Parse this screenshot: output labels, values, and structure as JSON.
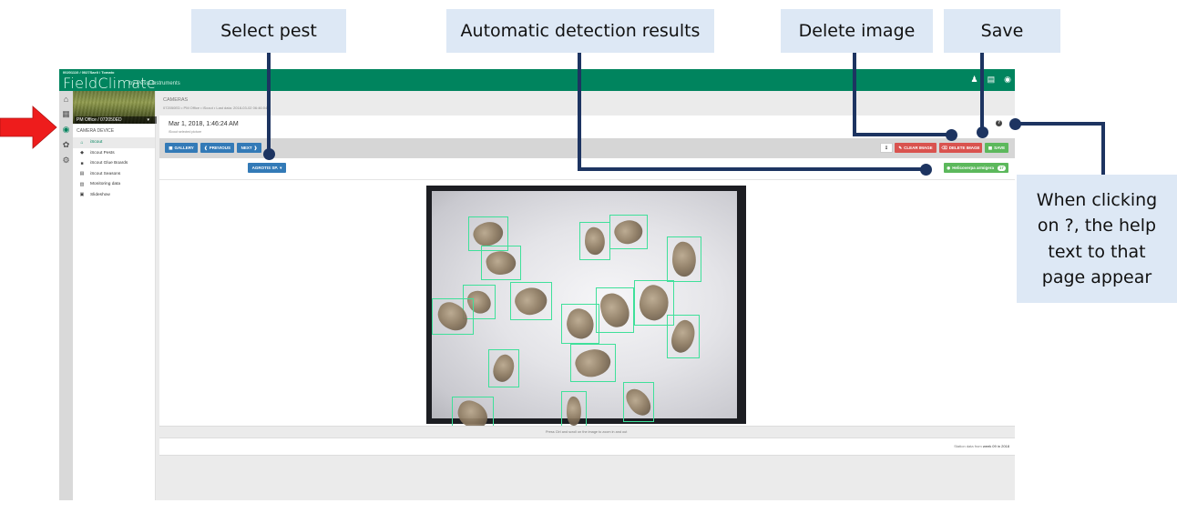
{
  "annotations": {
    "select_pest": "Select pest",
    "auto_detection": "Automatic detection results",
    "delete_image": "Delete image",
    "save": "Save",
    "help_note": "When clicking on ?, the help text to that page appear"
  },
  "app": {
    "breadcrumb_top": "00201110 / 0027Saeli / Tomato",
    "logo": "FieldClimate",
    "logo_sub": "by Pessl Instruments",
    "top_icons": [
      "user-icon",
      "folder-icon",
      "signal-icon"
    ]
  },
  "rail": {
    "items": [
      {
        "icon": "home-icon",
        "glyph": "⌂"
      },
      {
        "icon": "chart-icon",
        "glyph": "▦"
      },
      {
        "icon": "eye-icon",
        "glyph": "◉",
        "active": true
      },
      {
        "icon": "plant-icon",
        "glyph": "✿"
      },
      {
        "icon": "gear-icon",
        "glyph": "⚙"
      }
    ]
  },
  "sidebar": {
    "station": "PM Office / 072050ED",
    "section": "CAMERA DEVICE",
    "items": [
      {
        "label": "iScout",
        "icon": "home-icon",
        "glyph": "⌂",
        "active": true
      },
      {
        "label": "iScout Pests",
        "icon": "tag-icon",
        "glyph": "◆"
      },
      {
        "label": "iScout Glue Boards",
        "icon": "square-icon",
        "glyph": "■"
      },
      {
        "label": "iScout Seasons",
        "icon": "calendar-icon",
        "glyph": "▤"
      },
      {
        "label": "Monitoring data",
        "icon": "chart-icon",
        "glyph": "▥"
      },
      {
        "label": "Slideshow",
        "icon": "film-icon",
        "glyph": "▣"
      }
    ]
  },
  "page": {
    "title": "CAMERAS",
    "subtitle": "072050ED • PM Office • iScout • Last data: 2018-03-02 06:46:04",
    "date": "Mar 1, 2018, 1:46:24 AM",
    "date_sub": "iScout selected picture",
    "help": "?"
  },
  "toolbar": {
    "gallery": "GALLERY",
    "previous": "PREVIOUS",
    "next": "NEXT",
    "clear_image": "CLEAR IMAGE",
    "delete_image": "DELETE IMAGE",
    "save": "SAVE"
  },
  "filter": {
    "pest_select": "AGROTIS SP.",
    "detection_label": "Helicoverpa armigera",
    "detection_count": "17"
  },
  "image": {
    "detections_count": 17
  },
  "footer": {
    "hint": "Press Ctrl and scroll on the image to zoom in and out",
    "station_data_prefix": "Station data from",
    "station_data_value": "week 09 in 2018"
  },
  "colors": {
    "brand_green": "#00845e",
    "primary_blue": "#337ab7",
    "danger_red": "#d9534f",
    "success_green": "#5cb85c",
    "detection_box": "#3fe09a",
    "callout_bg": "#dde8f5",
    "callout_line": "#1d3461"
  }
}
